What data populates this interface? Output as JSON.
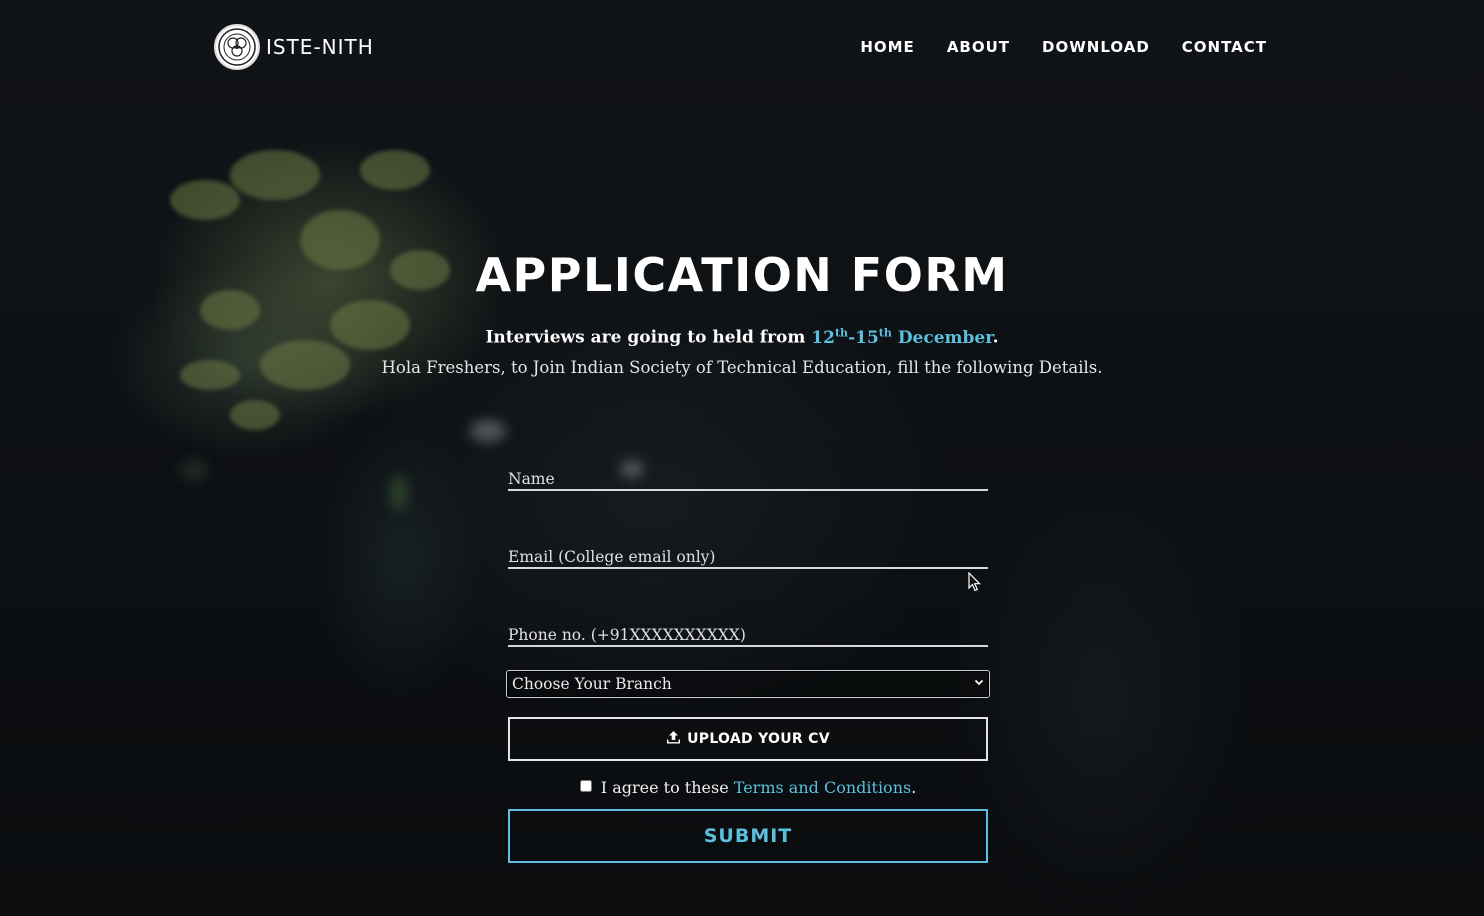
{
  "brand": {
    "name": "ISTE-NITH"
  },
  "nav": {
    "items": [
      "HOME",
      "ABOUT",
      "DOWNLOAD",
      "CONTACT"
    ]
  },
  "hero": {
    "title": "APPLICATION FORM",
    "notice_prefix": "Interviews are going to held from",
    "date_start": "12",
    "date_start_sup": "th",
    "date_sep": "-",
    "date_end": "15",
    "date_end_sup": "th",
    "month": "December",
    "notice_suffix": ".",
    "subtitle": "Hola Freshers, to Join Indian Society of Technical Education, fill the following Details."
  },
  "form": {
    "name_placeholder": "Name",
    "email_placeholder": "Email (College email only)",
    "phone_placeholder": "Phone no. (+91XXXXXXXXXX)",
    "branch_selected": "Choose Your Branch",
    "upload_label": "UPLOAD YOUR CV",
    "agree_prefix": "I agree to these",
    "terms_link": "Terms and Conditions",
    "agree_suffix": ".",
    "submit_label": "SUBMIT"
  },
  "icons": {
    "logo": "iste-logo-icon",
    "upload": "upload-icon",
    "chevron": "chevron-down-icon",
    "cursor": "mouse-pointer-icon"
  },
  "colors": {
    "accent": "#5bc0de",
    "background": "#0b0d10",
    "text": "#ffffff"
  }
}
